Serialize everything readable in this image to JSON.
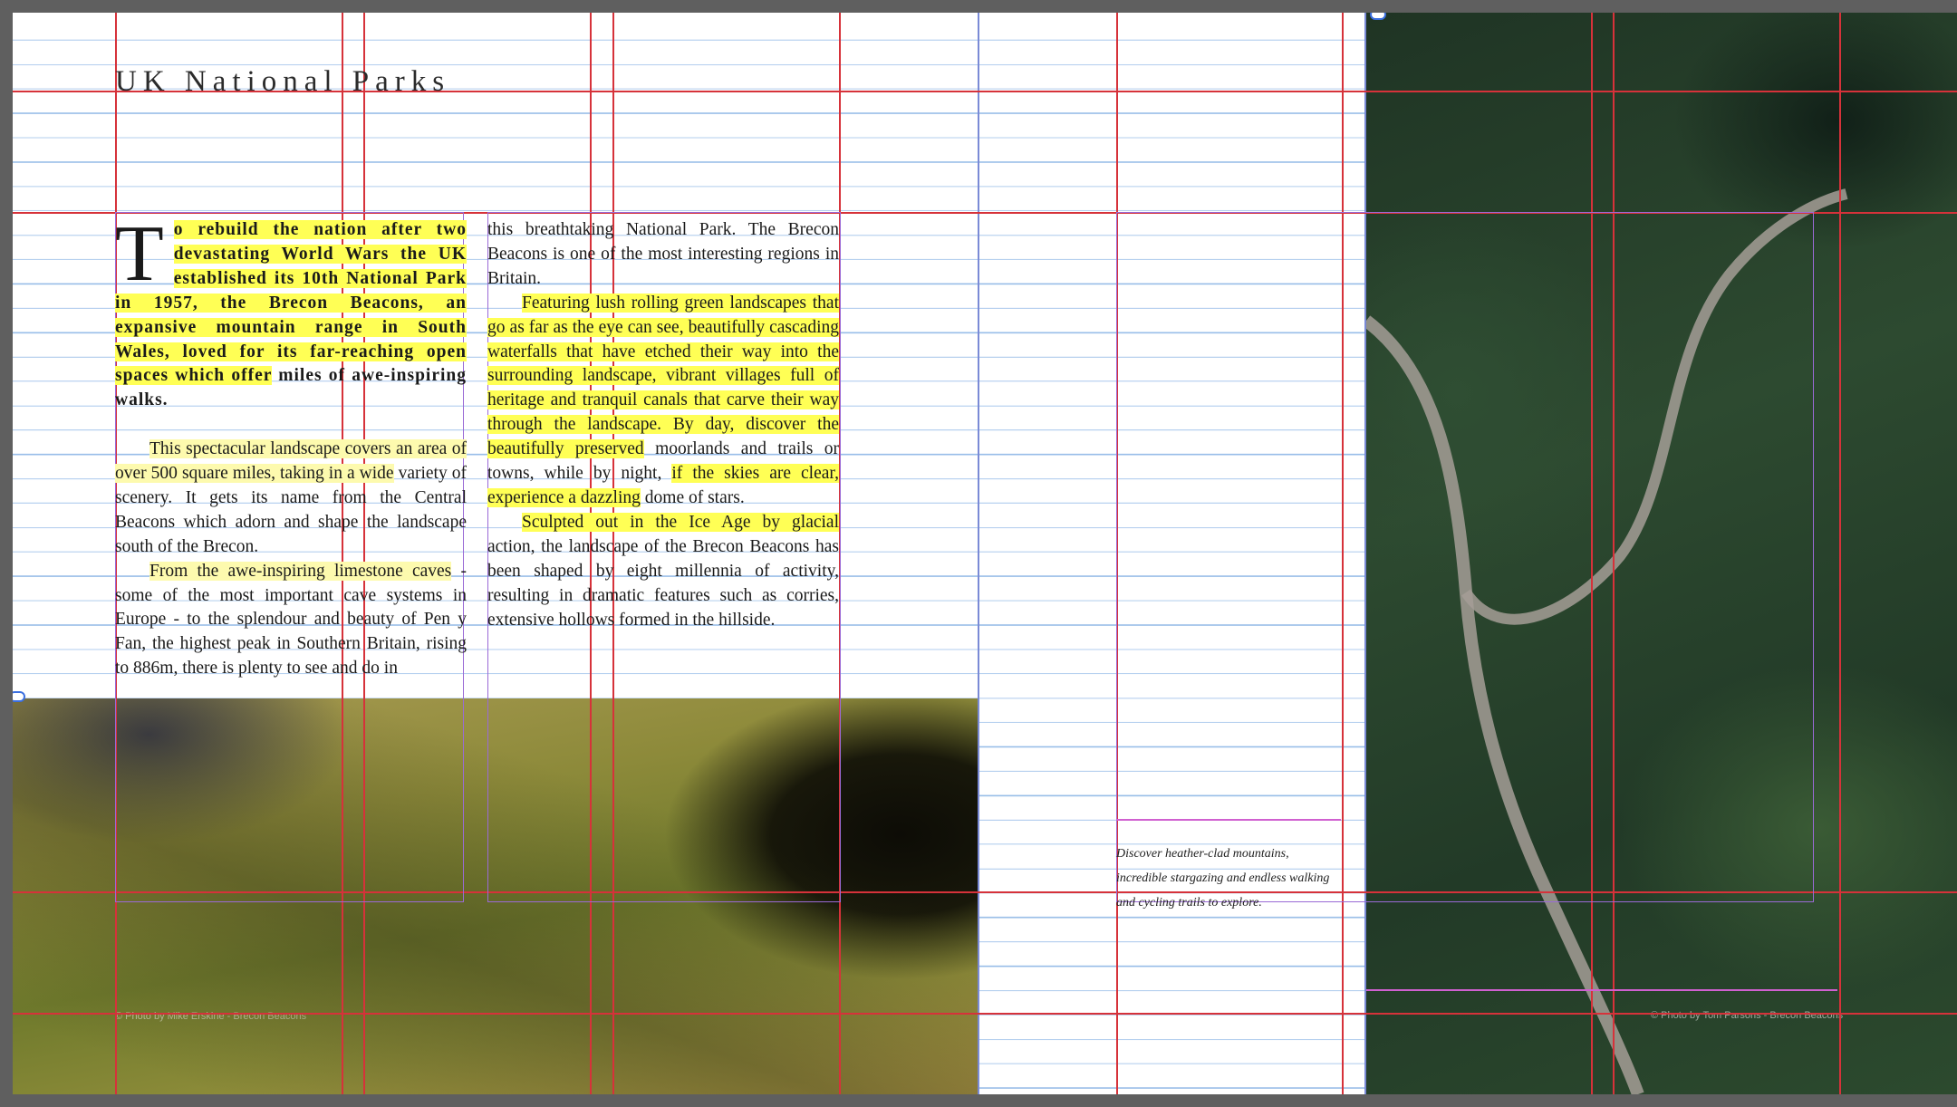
{
  "headline": "UK National Parks",
  "column1": {
    "dropcap": "T",
    "lede_parts": [
      "o rebuild the nation after two devastating World Wars the UK established its 10th National Park",
      " in 1957, the Brecon Beacons, an expansive mountain range in South Wales, loved for its far-reaching open spaces which offer",
      " miles of awe-inspiring walks."
    ],
    "para2_parts": [
      "This spectacular landscape covers an area of over 500 square miles, taking in a wide",
      " variety of scenery. It gets its name from the Central Beacons which adorn and shape the landscape south of the Brecon."
    ],
    "para3_parts": [
      "From the awe-inspiring limestone caves",
      " - some of the most important cave systems in Europe - to the splendour and beauty of Pen y Fan, the highest peak in Southern Britain, rising to 886m, there is plenty to see and do in"
    ]
  },
  "column2": {
    "para1": "this breathtaking National Park. The Brecon Beacons is one of the most interesting regions in Britain.",
    "para2_parts": [
      "Featuring lush rolling green landscapes that go as far as the eye can see, beautifully cascading waterfalls that have etched their way into the surrounding landscape, vibrant villages full of heritage and tranquil canals that carve their way through the landscape. By day, discover the beautifully preserved",
      " moorlands and trails or towns, while by night, ",
      "if the skies are clear, experience a dazzling",
      " dome of stars."
    ],
    "para3_parts": [
      "Sculpted out in the Ice Age by glacial",
      " action, the landscape of the Brecon Beacons has been shaped by eight millennia of activity, resulting in dramatic features such as corries, extensive hollows formed in the hillside."
    ]
  },
  "caption": "Discover heather-clad mountains, incredible stargazing and endless walking and cycling trails to explore.",
  "credits": {
    "valley": "© Photo by Mike Erskine - Brecon Beacons",
    "forest": "© Photo by Tom Parsons - Brecon Beacons"
  },
  "colors": {
    "highlight": "#ffff55",
    "guide": "#d6323a",
    "baseline": "#8fb7e6",
    "frame": "#9a6ad6"
  }
}
